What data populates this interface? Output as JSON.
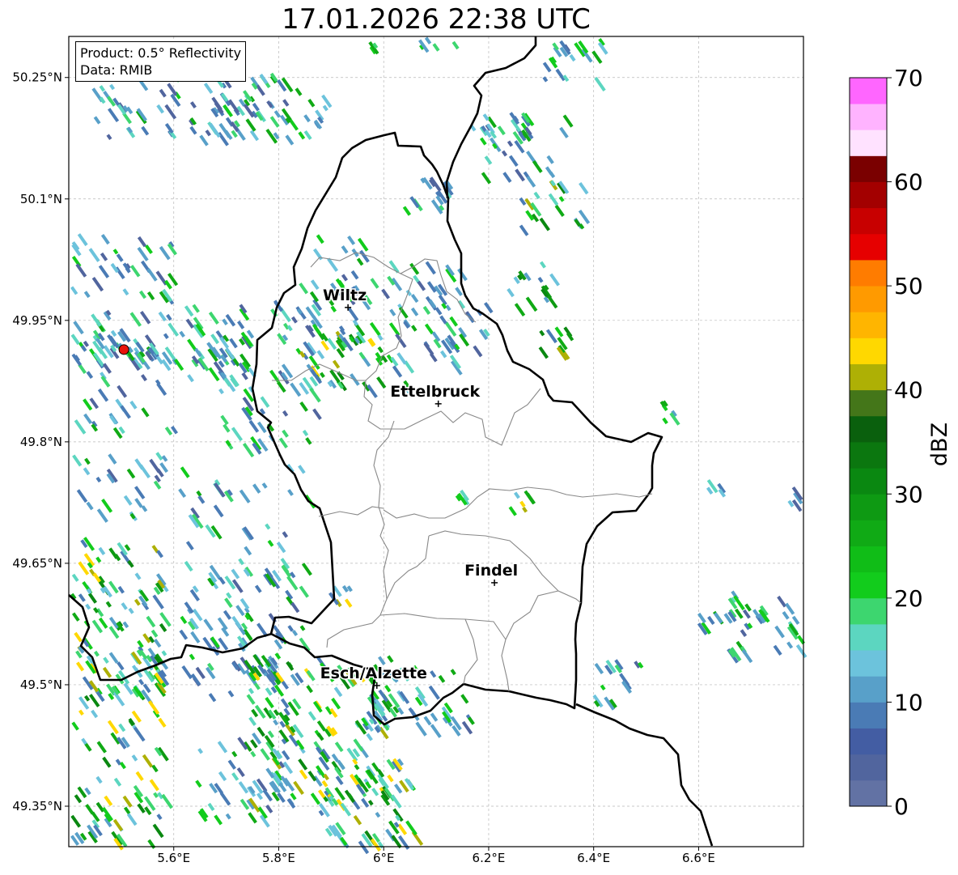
{
  "title": "17.01.2026 22:38 UTC",
  "info": {
    "product": "Product: 0.5° Reflectivity",
    "data": "Data: RMIB"
  },
  "map": {
    "lon_range": [
      5.4,
      6.8
    ],
    "lat_range": [
      49.3,
      50.3
    ],
    "x_ticks": [
      {
        "lon": 5.6,
        "label": "5.6°E"
      },
      {
        "lon": 5.8,
        "label": "5.8°E"
      },
      {
        "lon": 6.0,
        "label": "6°E"
      },
      {
        "lon": 6.2,
        "label": "6.2°E"
      },
      {
        "lon": 6.4,
        "label": "6.4°E"
      },
      {
        "lon": 6.6,
        "label": "6.6°E"
      }
    ],
    "y_ticks": [
      {
        "lat": 49.35,
        "label": "49.35°N"
      },
      {
        "lat": 49.5,
        "label": "49.5°N"
      },
      {
        "lat": 49.65,
        "label": "49.65°N"
      },
      {
        "lat": 49.8,
        "label": "49.8°N"
      },
      {
        "lat": 49.95,
        "label": "49.95°N"
      },
      {
        "lat": 50.1,
        "label": "50.1°N"
      },
      {
        "lat": 50.25,
        "label": "50.25°N"
      }
    ],
    "grid": true,
    "radar_site": {
      "lon": 5.505,
      "lat": 49.914,
      "color": "#e8140c"
    },
    "cities": [
      {
        "name": "Wiltz",
        "lon": 5.932,
        "lat": 49.966
      },
      {
        "name": "Ettelbruck",
        "lon": 6.104,
        "lat": 49.847
      },
      {
        "name": "Findel",
        "lon": 6.211,
        "lat": 49.626
      },
      {
        "name": "Esch/Alzette",
        "lon": 5.987,
        "lat": 49.499
      }
    ]
  },
  "colorbar": {
    "label": "dBZ",
    "min": 0,
    "max": 70,
    "step": 2.5,
    "ticks": [
      0,
      10,
      20,
      30,
      40,
      50,
      60,
      70
    ],
    "colors": [
      "#6272a4",
      "#51659e",
      "#435da3",
      "#4a7bb5",
      "#58a0c9",
      "#6cc3dc",
      "#5cd6c0",
      "#3dd66f",
      "#12cc1c",
      "#10bd17",
      "#10aa15",
      "#0e9a13",
      "#0a8811",
      "#0b770f",
      "#0a600d",
      "#447619",
      "#aeb005",
      "#ffd800",
      "#ffb500",
      "#ff9a00",
      "#ff7c00",
      "#e60000",
      "#c80000",
      "#a30000",
      "#7a0000",
      "#ffe2ff",
      "#ffb3ff",
      "#ff66ff",
      "#e833e8"
    ]
  }
}
